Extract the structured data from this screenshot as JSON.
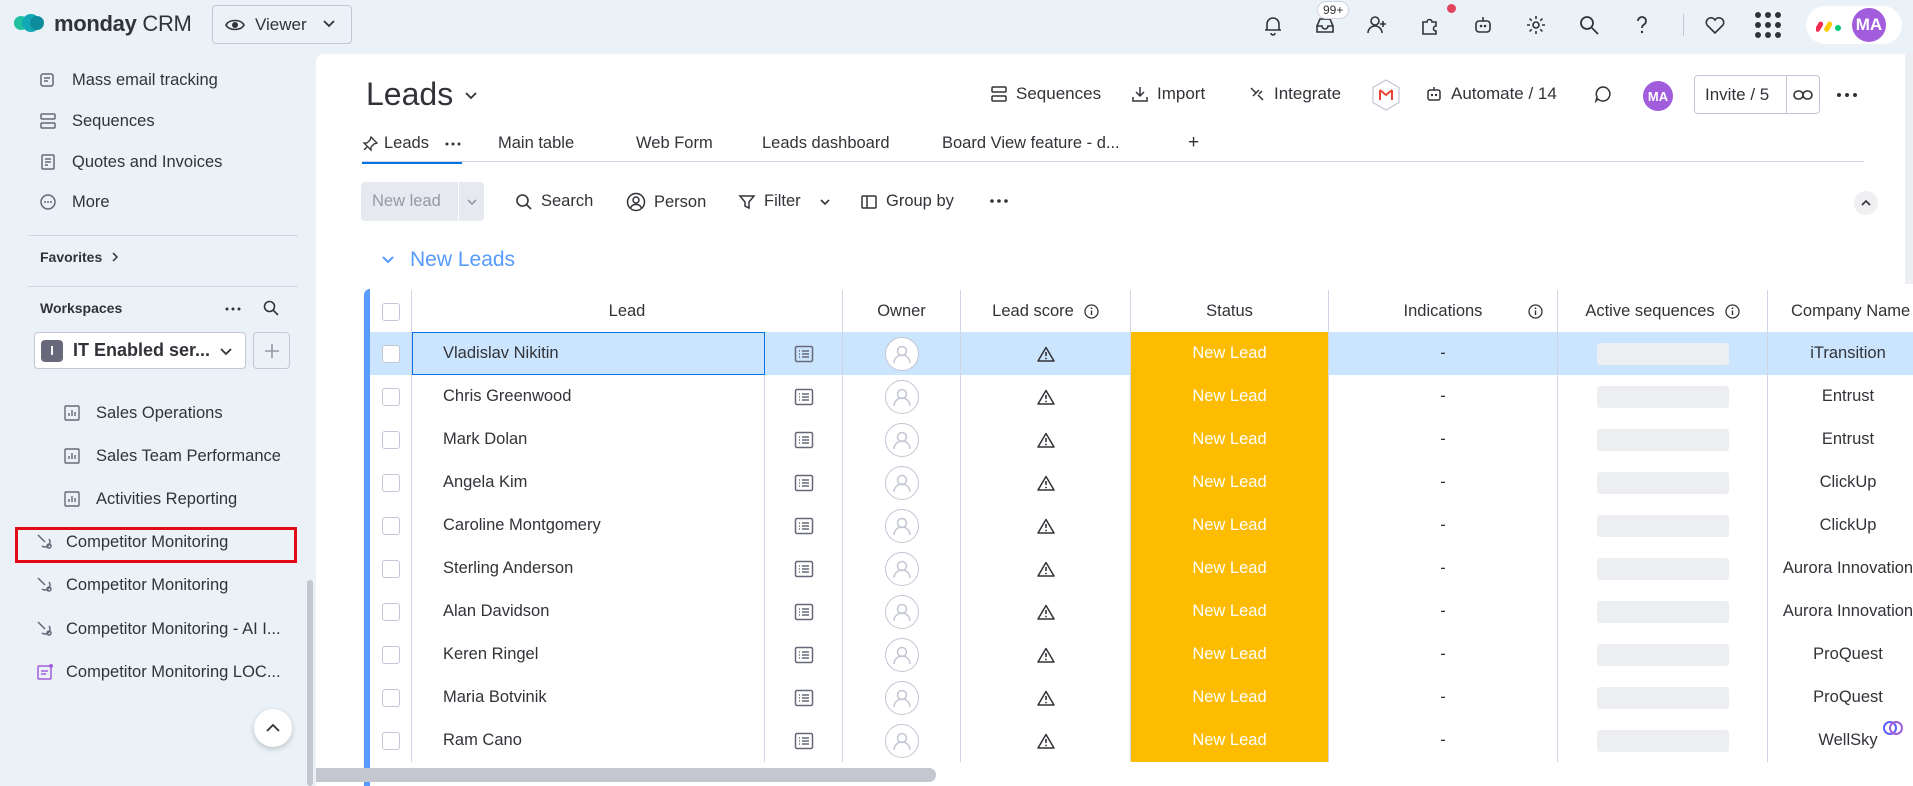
{
  "app": {
    "brand": "monday",
    "product": "CRM",
    "viewer_label": "Viewer",
    "notif_badge": "99+",
    "avatar_initials": "MA"
  },
  "sidebar": {
    "items": [
      {
        "label": "Mass email tracking",
        "icon": "email-tracking-icon"
      },
      {
        "label": "Sequences",
        "icon": "sequences-icon"
      },
      {
        "label": "Quotes and Invoices",
        "icon": "invoice-icon"
      },
      {
        "label": "More",
        "icon": "more-circle-icon"
      }
    ],
    "favorites_label": "Favorites",
    "workspaces_label": "Workspaces",
    "workspace": {
      "letter": "I",
      "name": "IT Enabled ser..."
    },
    "boards": [
      {
        "label": "Sales Operations"
      },
      {
        "label": "Sales Team Performance"
      },
      {
        "label": "Activities Reporting"
      }
    ],
    "competitor_items": [
      {
        "label": "Competitor Monitoring"
      },
      {
        "label": "Competitor Monitoring"
      },
      {
        "label": "Competitor Monitoring - AI I..."
      },
      {
        "label": "Competitor Monitoring LOC..."
      }
    ]
  },
  "board": {
    "title": "Leads",
    "actions": {
      "sequences": "Sequences",
      "import": "Import",
      "integrate": "Integrate",
      "automate": "Automate / 14",
      "invite": "Invite / 5",
      "avatar": "MA"
    },
    "tabs": [
      {
        "label": "Leads"
      },
      {
        "label": "Main table"
      },
      {
        "label": "Web Form"
      },
      {
        "label": "Leads dashboard"
      },
      {
        "label": "Board View feature - d..."
      },
      {
        "label": "+"
      }
    ],
    "toolbar": {
      "new_item": "New lead",
      "search": "Search",
      "person": "Person",
      "filter": "Filter",
      "group_by": "Group by"
    },
    "group_title": "New Leads",
    "columns": {
      "lead": "Lead",
      "owner": "Owner",
      "lead_score": "Lead score",
      "status": "Status",
      "indications": "Indications",
      "active_sequences": "Active sequences",
      "company": "Company Name"
    },
    "rows": [
      {
        "lead": "Vladislav Nikitin",
        "status": "New Lead",
        "indications": "-",
        "company": "iTransition"
      },
      {
        "lead": "Chris Greenwood",
        "status": "New Lead",
        "indications": "-",
        "company": "Entrust"
      },
      {
        "lead": "Mark Dolan",
        "status": "New Lead",
        "indications": "-",
        "company": "Entrust"
      },
      {
        "lead": "Angela Kim",
        "status": "New Lead",
        "indications": "-",
        "company": "ClickUp"
      },
      {
        "lead": "Caroline Montgomery",
        "status": "New Lead",
        "indications": "-",
        "company": "ClickUp"
      },
      {
        "lead": "Sterling Anderson",
        "status": "New Lead",
        "indications": "-",
        "company": "Aurora Innovation"
      },
      {
        "lead": "Alan Davidson",
        "status": "New Lead",
        "indications": "-",
        "company": "Aurora Innovation"
      },
      {
        "lead": "Keren Ringel",
        "status": "New Lead",
        "indications": "-",
        "company": "ProQuest"
      },
      {
        "lead": "Maria Botvinik",
        "status": "New Lead",
        "indications": "-",
        "company": "ProQuest"
      },
      {
        "lead": "Ram Cano",
        "status": "New Lead",
        "indications": "-",
        "company": "WellSky"
      }
    ]
  },
  "colors": {
    "status_new_lead": "#fdbc00",
    "group_blue": "#579bfc",
    "accent": "#0073ea",
    "highlight_box": "#e50914"
  }
}
